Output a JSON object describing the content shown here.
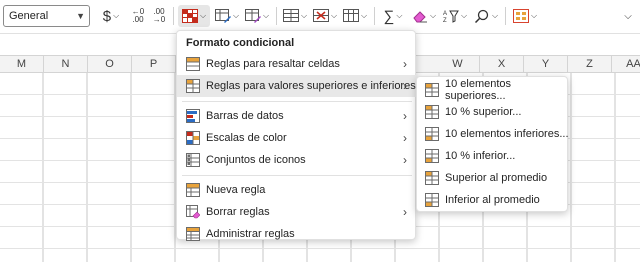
{
  "ribbon": {
    "number_format": {
      "value": "General"
    },
    "currency_symbol": "$",
    "increase_decimals": {
      "top": "←0",
      "bottom": ".00"
    },
    "decrease_decimals": {
      "top": ".00",
      "bottom": "→0"
    },
    "sum_symbol": "∑",
    "colors": {
      "conditional_red": "#c42b1c",
      "accent_orange": "#e8a33c",
      "blue": "#2b6cc4",
      "purple": "#a24bc4"
    }
  },
  "grid": {
    "columns": [
      "M",
      "N",
      "O",
      "P",
      "W",
      "X",
      "Y",
      "Z",
      "AA"
    ]
  },
  "menu": {
    "title": "Formato condicional",
    "items": [
      {
        "label": "Reglas para resaltar celdas",
        "has_submenu": true,
        "icon": "highlight-rules-icon"
      },
      {
        "label": "Reglas para valores superiores e inferiores",
        "has_submenu": true,
        "icon": "top-bottom-rules-icon",
        "hovered": true
      },
      {
        "label": "Barras de datos",
        "has_submenu": true,
        "icon": "data-bars-icon"
      },
      {
        "label": "Escalas de color",
        "has_submenu": true,
        "icon": "color-scales-icon"
      },
      {
        "label": "Conjuntos de iconos",
        "has_submenu": true,
        "icon": "icon-sets-icon"
      },
      {
        "label": "Nueva regla",
        "has_submenu": false,
        "icon": "new-rule-icon"
      },
      {
        "label": "Borrar reglas",
        "has_submenu": true,
        "icon": "clear-rules-icon"
      },
      {
        "label": "Administrar reglas",
        "has_submenu": false,
        "icon": "manage-rules-icon"
      }
    ]
  },
  "submenu": {
    "items": [
      {
        "label": "10 elementos superiores...",
        "icon": "top-10-items-icon"
      },
      {
        "label": "10 % superior...",
        "icon": "top-10-percent-icon"
      },
      {
        "label": "10 elementos inferiores...",
        "icon": "bottom-10-items-icon"
      },
      {
        "label": "10 % inferior...",
        "icon": "bottom-10-percent-icon"
      },
      {
        "label": "Superior al promedio",
        "icon": "above-average-icon"
      },
      {
        "label": "Inferior al promedio",
        "icon": "below-average-icon"
      }
    ]
  },
  "arrow_glyph": "›"
}
